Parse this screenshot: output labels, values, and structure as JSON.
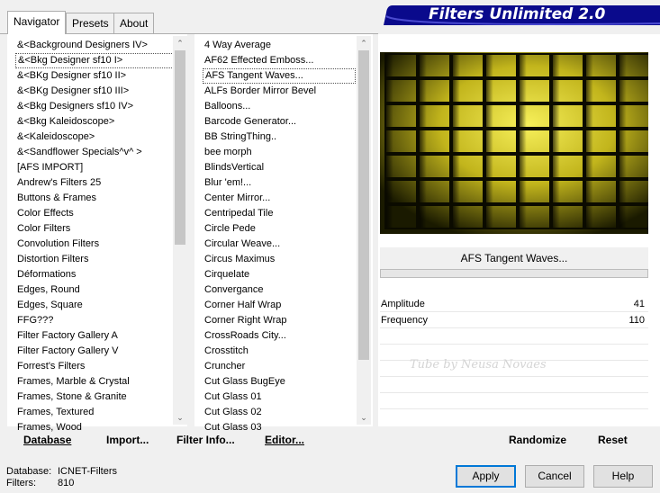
{
  "tabs": [
    {
      "label": "Navigator"
    },
    {
      "label": "Presets"
    },
    {
      "label": "About"
    }
  ],
  "banner": {
    "title": "Filters Unlimited 2.0",
    "color": "#0a0a8c"
  },
  "categories": {
    "selected_index": 1,
    "items": [
      "&<Background Designers IV>",
      "&<Bkg Designer sf10 I>",
      "&<BKg Designer sf10 II>",
      "&<BKg Designer sf10 III>",
      "&<Bkg Designers sf10 IV>",
      "&<Bkg Kaleidoscope>",
      "&<Kaleidoscope>",
      "&<Sandflower Specials^v^ >",
      "[AFS IMPORT]",
      "Andrew's Filters 25",
      "Buttons & Frames",
      "Color Effects",
      "Color Filters",
      "Convolution Filters",
      "Distortion Filters",
      "Déformations",
      "Edges, Round",
      "Edges, Square",
      "FFG???",
      "Filter Factory Gallery A",
      "Filter Factory Gallery V",
      "Forrest's Filters",
      "Frames, Marble & Crystal",
      "Frames, Stone & Granite",
      "Frames, Textured",
      "Frames, Wood"
    ]
  },
  "filters": {
    "selected_index": 2,
    "items": [
      "4 Way Average",
      "AF62 Effected Emboss...",
      "AFS Tangent Waves...",
      "ALFs Border Mirror Bevel",
      "Balloons...",
      "Barcode Generator...",
      "BB StringThing..",
      "bee morph",
      "BlindsVertical",
      "Blur 'em!...",
      "Center Mirror...",
      "Centripedal Tile",
      "Circle Pede",
      "Circular Weave...",
      "Circus Maximus",
      "Cirquelate",
      "Convergance",
      "Corner Half Wrap",
      "Corner Right Wrap",
      "CrossRoads City...",
      "Crosstitch",
      "Cruncher",
      "Cut Glass  BugEye",
      "Cut Glass 01",
      "Cut Glass 02",
      "Cut Glass 03"
    ]
  },
  "preview": {
    "filter_name": "AFS Tangent Waves...",
    "watermark": "Tube by Neusa Novaes"
  },
  "parameters": [
    {
      "label": "Amplitude",
      "value": "41"
    },
    {
      "label": "Frequency",
      "value": "110"
    }
  ],
  "toolbar": {
    "database": "Database",
    "import": "Import...",
    "filter_info": "Filter Info...",
    "editor": "Editor...",
    "randomize": "Randomize",
    "reset": "Reset"
  },
  "status": {
    "database_label": "Database:",
    "database_value": "ICNET-Filters",
    "filters_label": "Filters:",
    "filters_value": "810"
  },
  "buttons": {
    "apply": "Apply",
    "cancel": "Cancel",
    "help": "Help"
  }
}
